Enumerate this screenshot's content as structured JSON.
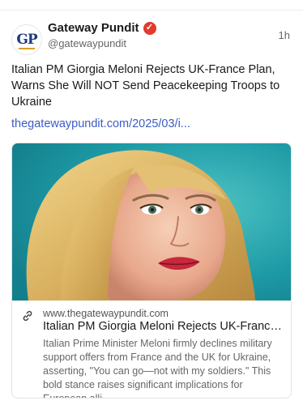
{
  "post": {
    "author": {
      "display_name": "Gateway Pundit",
      "handle": "@gatewaypundit",
      "avatar_initials_g": "G",
      "avatar_initials_p": "P",
      "verified_icon": "verified-badge-icon"
    },
    "time": "1h",
    "text": "Italian PM Giorgia Meloni Rejects UK-France Plan, Warns She Will NOT Send Peacekeeping Troops to Ukraine",
    "link_text": "thegatewaypundit.com/2025/03/i..."
  },
  "card": {
    "domain": "www.thegatewaypundit.com",
    "title": "Italian PM Giorgia Meloni Rejects UK-France Pl...",
    "description": "Italian Prime Minister Meloni firmly declines military support offers from France and the UK for Ukraine, asserting, \"You can go—not with my soldiers.\" This bold stance raises significant implications for European alli...",
    "icon": "link-icon"
  },
  "colors": {
    "accent_link": "#3b5cc4",
    "verified_badge": "#e23b2e",
    "image_background": "#1f9fa8"
  }
}
